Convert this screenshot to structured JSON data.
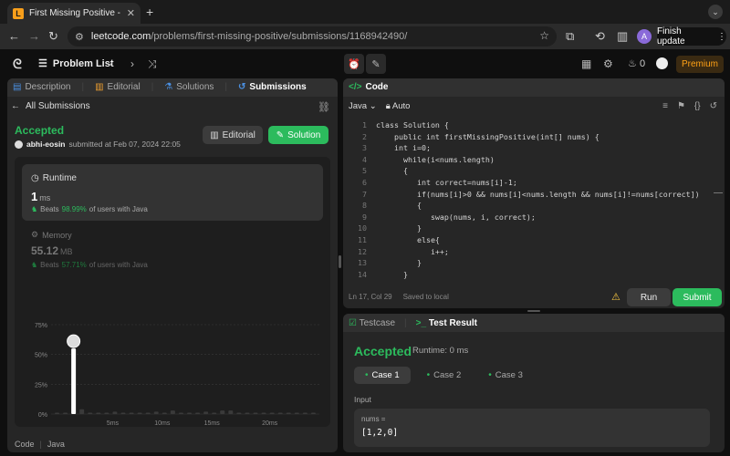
{
  "browser": {
    "tab_title": "First Missing Positive - LeetC",
    "url_host": "leetcode.com",
    "url_path": "/problems/first-missing-positive/submissions/1168942490/",
    "profile_initial": "A",
    "finish_update_label": "Finish update"
  },
  "nav": {
    "problem_list_label": "Problem List",
    "streak_count": "0",
    "premium_label": "Premium"
  },
  "left_panel": {
    "tabs": [
      {
        "label": "Description"
      },
      {
        "label": "Editorial"
      },
      {
        "label": "Solutions"
      },
      {
        "label": "Submissions"
      }
    ],
    "back_label": "All Submissions",
    "status": "Accepted",
    "submitter": "abhi-eosin",
    "submitted_text": "submitted at Feb 07, 2024 22:05",
    "editorial_button": "Editorial",
    "solution_button": "Solution",
    "runtime": {
      "title": "Runtime",
      "value": "1",
      "unit": "ms",
      "beats_label": "Beats",
      "beats_pct": "98.99%",
      "beats_suffix": "of users with Java"
    },
    "memory": {
      "title": "Memory",
      "value": "55.12",
      "unit": "MB",
      "beats_label": "Beats",
      "beats_pct": "57.71%",
      "beats_suffix": "of users with Java"
    },
    "footer": {
      "code_label": "Code",
      "lang_label": "Java"
    }
  },
  "chart_data": {
    "type": "bar",
    "ylabels": [
      "75%",
      "50%",
      "25%",
      "0%"
    ],
    "xticks": [
      "5ms",
      "10ms",
      "15ms",
      "20ms"
    ],
    "mini_xticks": [
      "5ms",
      "10ms",
      "15ms",
      "20ms"
    ],
    "values": [
      1,
      1,
      55,
      4,
      1,
      1,
      1,
      2,
      1,
      1,
      1,
      1,
      2,
      1,
      3,
      1,
      1,
      1,
      2,
      1,
      3,
      3,
      1,
      1,
      1,
      1,
      1,
      1,
      1,
      1,
      1,
      1
    ],
    "highlight_index": 2,
    "ylim": [
      0,
      75
    ],
    "colors": {
      "highlight": "#ffffff",
      "bar": "#3a3a3a",
      "grid": "#3a3a3a"
    }
  },
  "code_panel": {
    "title": "Code",
    "language": "Java",
    "mode": "Auto",
    "lines": [
      {
        "n": "1",
        "code": "class Solution {"
      },
      {
        "n": "2",
        "code": "    public int firstMissingPositive(int[] nums) {"
      },
      {
        "n": "3",
        "code": "    int i=0;"
      },
      {
        "n": "4",
        "code": "      while(i<nums.length)"
      },
      {
        "n": "5",
        "code": "      {"
      },
      {
        "n": "6",
        "code": "         int correct=nums[i]-1;"
      },
      {
        "n": "7",
        "code": "         if(nums[i]>0 && nums[i]<nums.length && nums[i]!=nums[correct])"
      },
      {
        "n": "8",
        "code": "         {"
      },
      {
        "n": "9",
        "code": "            swap(nums, i, correct);"
      },
      {
        "n": "10",
        "code": "         }"
      },
      {
        "n": "11",
        "code": "         else{"
      },
      {
        "n": "12",
        "code": "            i++;"
      },
      {
        "n": "13",
        "code": "         }"
      },
      {
        "n": "14",
        "code": "      }"
      }
    ],
    "cursor": "Ln 17, Col 29",
    "saved": "Saved to local",
    "run_label": "Run",
    "submit_label": "Submit"
  },
  "result_panel": {
    "testcase_tab": "Testcase",
    "result_tab": "Test Result",
    "status": "Accepted",
    "runtime": "Runtime: 0 ms",
    "cases": [
      "Case 1",
      "Case 2",
      "Case 3"
    ],
    "input_label": "Input",
    "param_name": "nums =",
    "param_value": "[1,2,0]"
  }
}
